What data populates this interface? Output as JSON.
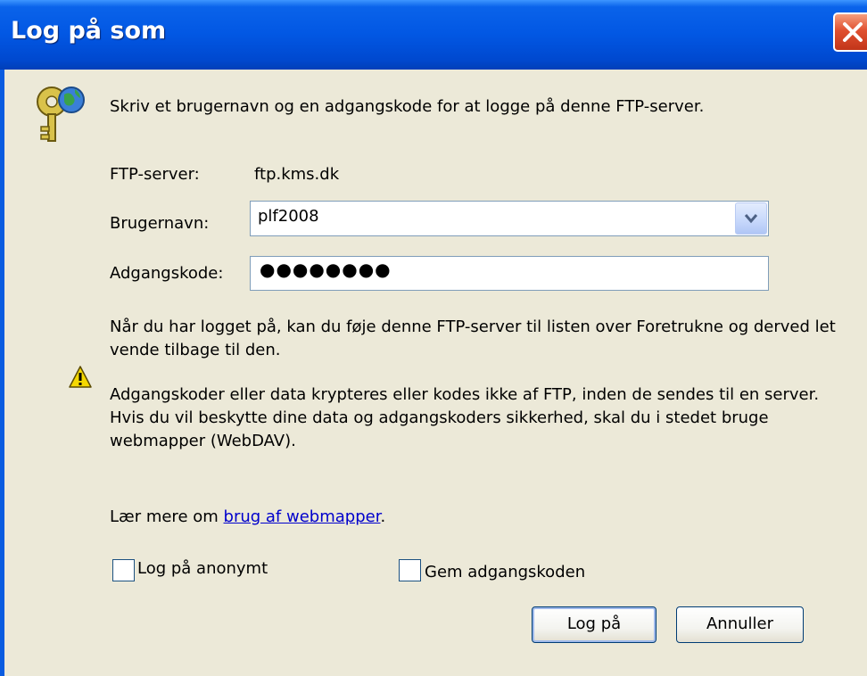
{
  "window": {
    "title": "Log på som"
  },
  "intro_text": "Skriv et brugernavn og en adgangskode for at logge på denne FTP-server.",
  "server": {
    "label": "FTP-server:",
    "value": "ftp.kms.dk"
  },
  "username": {
    "label": "Brugernavn:",
    "value": "plf2008"
  },
  "password": {
    "label": "Adgangskode:",
    "masked_value": "●●●●●●●●"
  },
  "info_text": "Når du har logget på, kan du føje denne FTP-server til listen over Foretrukne og derved let vende tilbage til den.",
  "warning_text": "Adgangskoder eller data krypteres eller kodes ikke af FTP, inden de sendes til en server. Hvis du vil beskytte dine data og adgangskoders sikkerhed, skal du i stedet bruge webmapper (WebDAV).",
  "learn_more": {
    "prefix": "Lær mere om ",
    "link": "brug af webmapper",
    "suffix": "."
  },
  "checkboxes": {
    "anonymous": "Log på anonymt",
    "save_password": "Gem adgangskoden"
  },
  "buttons": {
    "login": "Log på",
    "cancel": "Annuller"
  },
  "icons": {
    "login": "keys-globe-icon",
    "warning": "warning-icon",
    "close": "close-icon",
    "dropdown": "chevron-down-icon"
  }
}
